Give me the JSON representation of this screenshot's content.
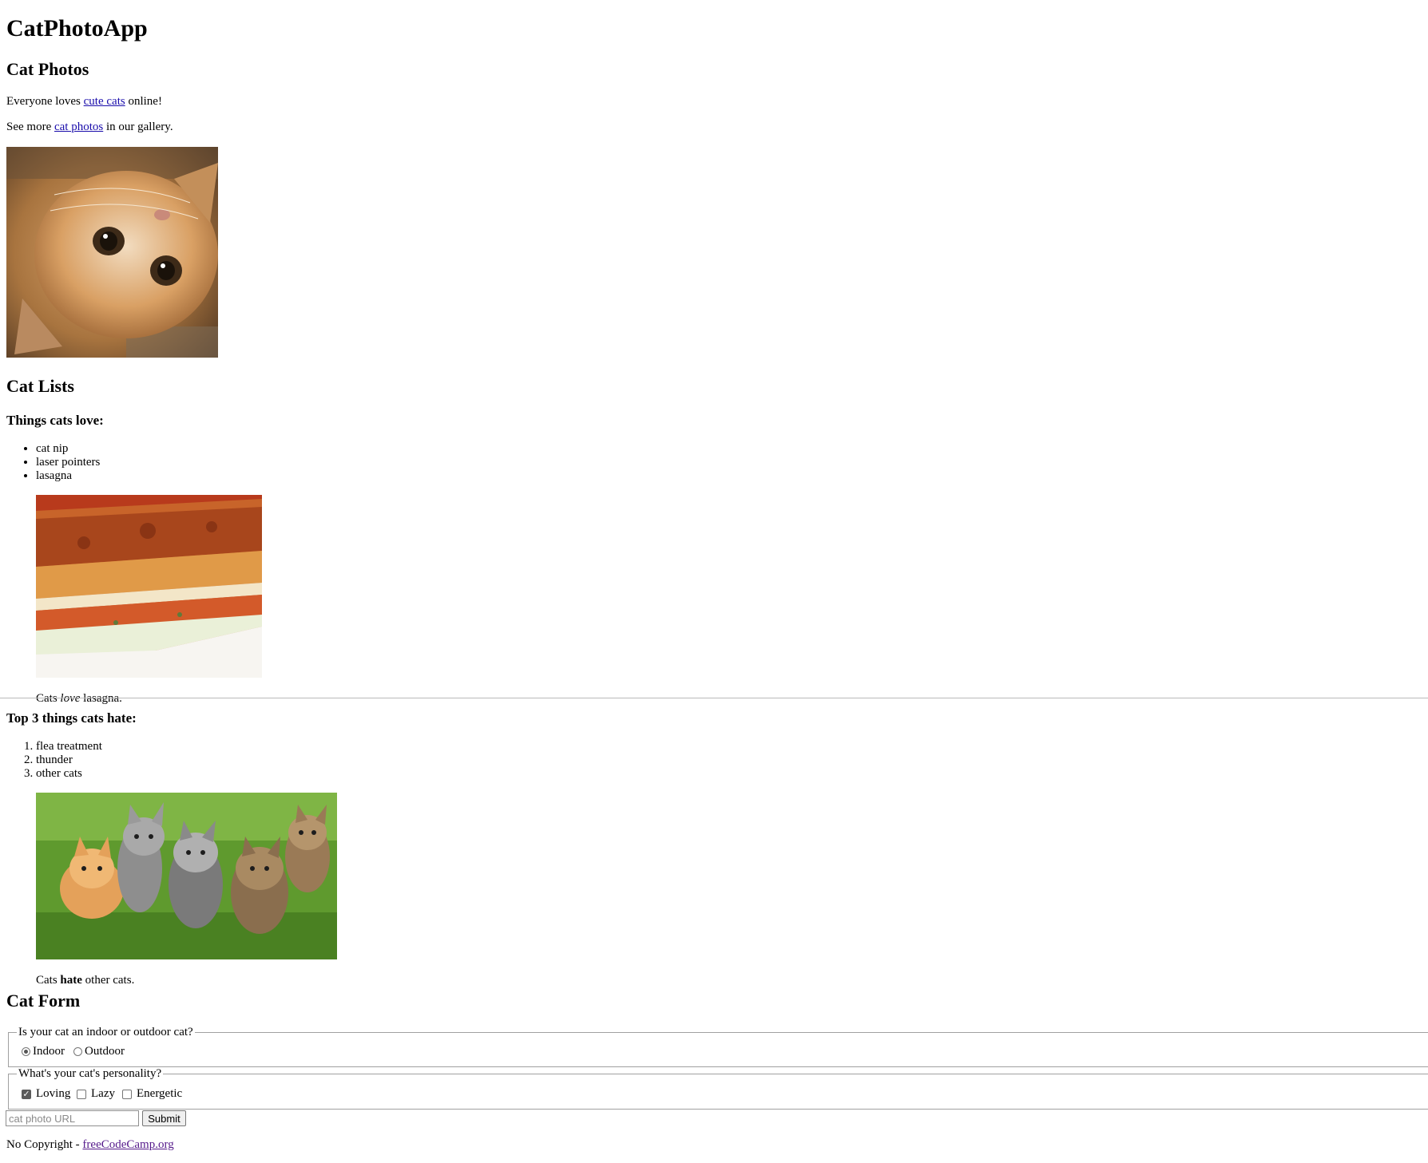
{
  "header": {
    "title": "CatPhotoApp"
  },
  "cat_photos": {
    "heading": "Cat Photos",
    "para1": {
      "before": "Everyone loves ",
      "link": "cute cats",
      "after": " online!"
    },
    "para2": {
      "before": "See more ",
      "link": "cat photos",
      "after": " in our gallery."
    }
  },
  "cat_lists": {
    "heading": "Cat Lists",
    "love": {
      "heading": "Things cats love:",
      "items": [
        "cat nip",
        "laser pointers",
        "lasagna"
      ],
      "caption": {
        "before": "Cats ",
        "em": "love",
        "after": " lasagna."
      }
    },
    "hate": {
      "heading": "Top 3 things cats hate:",
      "items": [
        "flea treatment",
        "thunder",
        "other cats"
      ],
      "caption": {
        "before": "Cats ",
        "strong": "hate",
        "after": " other cats."
      }
    }
  },
  "cat_form": {
    "heading": "Cat Form",
    "location": {
      "legend": "Is your cat an indoor or outdoor cat?",
      "options": [
        {
          "label": "Indoor",
          "checked": true
        },
        {
          "label": "Outdoor",
          "checked": false
        }
      ]
    },
    "personality": {
      "legend": "What's your cat's personality?",
      "options": [
        {
          "label": "Loving",
          "checked": true
        },
        {
          "label": "Lazy",
          "checked": false
        },
        {
          "label": "Energetic",
          "checked": false
        }
      ]
    },
    "url_placeholder": "cat photo URL",
    "submit_label": "Submit"
  },
  "footer": {
    "before": "No Copyright - ",
    "link": "freeCodeCamp.org"
  }
}
